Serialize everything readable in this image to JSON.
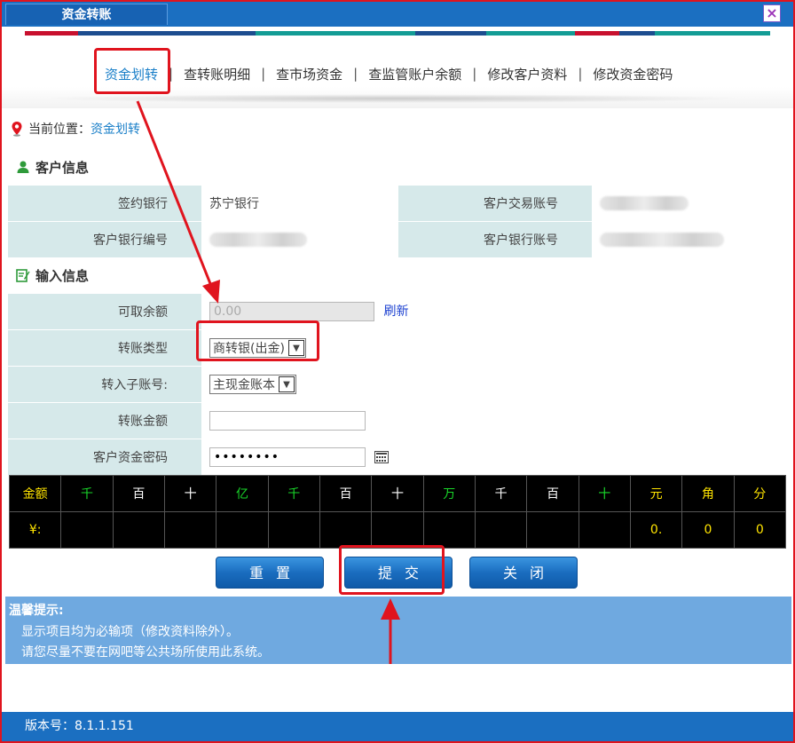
{
  "window": {
    "title": "资金转账",
    "close_icon": "×"
  },
  "colors": {
    "accent": "#1b6fc1",
    "highlight": "#e0141e",
    "label_bg": "#d6e9ea",
    "tips_bg": "#6fa9e0"
  },
  "nav": {
    "items": [
      "资金划转",
      "查转账明细",
      "查市场资金",
      "查监管账户余额",
      "修改客户资料",
      "修改资金密码"
    ],
    "active": "资金划转",
    "separator": "|"
  },
  "location": {
    "label": "当前位置：",
    "current": "资金划转"
  },
  "customer_info": {
    "title": "客户信息",
    "bank_label": "签约银行",
    "bank_value": "苏宁银行",
    "trade_account_label": "客户交易账号",
    "bank_code_label": "客户银行编号",
    "bank_account_label": "客户银行账号"
  },
  "input_info": {
    "title": "输入信息",
    "balance_label": "可取余额",
    "balance_value": "0.00",
    "refresh": "刷新",
    "type_label": "转账类型",
    "type_value": "商转银(出金)",
    "sub_account_label": "转入子账号:",
    "sub_account_value": "主现金账本",
    "amount_label": "转账金额",
    "amount_value": "",
    "password_label": "客户资金密码",
    "password_value": "••••••••"
  },
  "amount_grid": {
    "header": [
      "金额",
      "千",
      "百",
      "十",
      "亿",
      "千",
      "百",
      "十",
      "万",
      "千",
      "百",
      "十",
      "元",
      "角",
      "分"
    ],
    "values": [
      "¥:",
      "",
      "",
      "",
      "",
      "",
      "",
      "",
      "",
      "",
      "",
      "",
      "0.",
      "0",
      "0"
    ]
  },
  "buttons": {
    "reset": "重置",
    "submit": "提交",
    "close": "关闭"
  },
  "tips": {
    "title": "温馨提示:",
    "lines": [
      "显示项目均为必输项（修改资料除外）。",
      "请您尽量不要在网吧等公共场所使用此系统。"
    ]
  },
  "footer": {
    "version": "版本号：8.1.1.151"
  }
}
